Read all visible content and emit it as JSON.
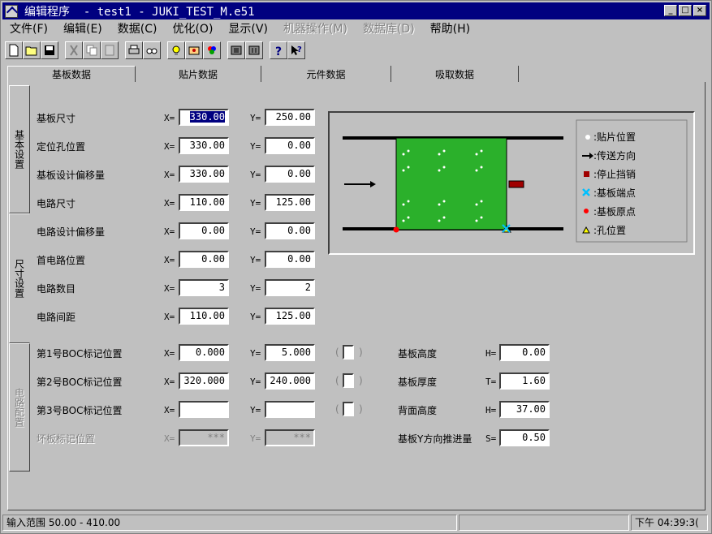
{
  "window": {
    "title": "编辑程序  - test1 - JUKI_TEST_M.e51",
    "min_glyph": "_",
    "max_glyph": "□",
    "close_glyph": "×"
  },
  "menu": [
    {
      "label": "文件(F)",
      "enabled": true
    },
    {
      "label": "编辑(E)",
      "enabled": true
    },
    {
      "label": "数据(C)",
      "enabled": true
    },
    {
      "label": "优化(O)",
      "enabled": true
    },
    {
      "label": "显示(V)",
      "enabled": true
    },
    {
      "label": "机器操作(M)",
      "enabled": false
    },
    {
      "label": "数据库(D)",
      "enabled": false
    },
    {
      "label": "帮助(H)",
      "enabled": true
    }
  ],
  "toolbar_icons": [
    "new-file-icon",
    "open-folder-icon",
    "save-icon",
    "cut-icon",
    "copy-icon",
    "paste-icon",
    "print-icon",
    "find-icon",
    "optimize-bulb-icon",
    "tools-icon",
    "color-icon",
    "view-icon",
    "view2-icon",
    "help-icon",
    "context-help-icon"
  ],
  "tabs": [
    "基板数据",
    "贴片数据",
    "元件数据",
    "吸取数据"
  ],
  "side_tabs": [
    "基本设置",
    "尺寸设置",
    "电路配置"
  ],
  "rows": [
    {
      "label": "基板尺寸",
      "x": "330.00",
      "y": "250.00",
      "x_selected": true
    },
    {
      "label": "定位孔位置",
      "x": "330.00",
      "y": "0.00"
    },
    {
      "label": "基板设计偏移量",
      "x": "330.00",
      "y": "0.00"
    },
    {
      "label": "电路尺寸",
      "x": "110.00",
      "y": "125.00"
    },
    {
      "label": "电路设计偏移量",
      "x": "0.00",
      "y": "0.00"
    },
    {
      "label": "首电路位置",
      "x": "0.00",
      "y": "0.00"
    },
    {
      "label": "电路数目",
      "x": "3",
      "y": "2"
    },
    {
      "label": "电路间距",
      "x": "110.00",
      "y": "125.00"
    }
  ],
  "boc_rows": [
    {
      "label": "第1号BOC标记位置",
      "x": "0.000",
      "y": "5.000"
    },
    {
      "label": "第2号BOC标记位置",
      "x": "320.000",
      "y": "240.000"
    },
    {
      "label": "第3号BOC标记位置",
      "x": "",
      "y": ""
    },
    {
      "label": "坏板标记位置",
      "x": "***",
      "y": "***",
      "disabled": true
    }
  ],
  "axis_x": "X=",
  "axis_y": "Y=",
  "paren_open": "(",
  "paren_close": ")",
  "right_fields": [
    {
      "label": "基板高度",
      "axis": "H=",
      "value": "0.00"
    },
    {
      "label": "基板厚度",
      "axis": "T=",
      "value": "1.60"
    },
    {
      "label": "背面高度",
      "axis": "H=",
      "value": "37.00"
    },
    {
      "label": "基板Y方向推进量",
      "axis": "S=",
      "value": "0.50"
    }
  ],
  "legend": [
    {
      "label": ":贴片位置",
      "icon": "white-dot"
    },
    {
      "label": ":传送方向",
      "icon": "arrow"
    },
    {
      "label": ":停止挡销",
      "icon": "dark-red-square"
    },
    {
      "label": ":基板端点",
      "icon": "cyan-x"
    },
    {
      "label": ":基板原点",
      "icon": "red-dot"
    },
    {
      "label": ":孔位置",
      "icon": "yellow-triangle"
    }
  ],
  "colors": {
    "board": "#2bb02b",
    "stopper": "#a00000",
    "origin": "#ff0000",
    "endpoint": "#00c0ff",
    "hole": "#ffff00"
  },
  "status": {
    "range": "输入范围  50.00 - 410.00",
    "time": "下午 04:39:3("
  }
}
